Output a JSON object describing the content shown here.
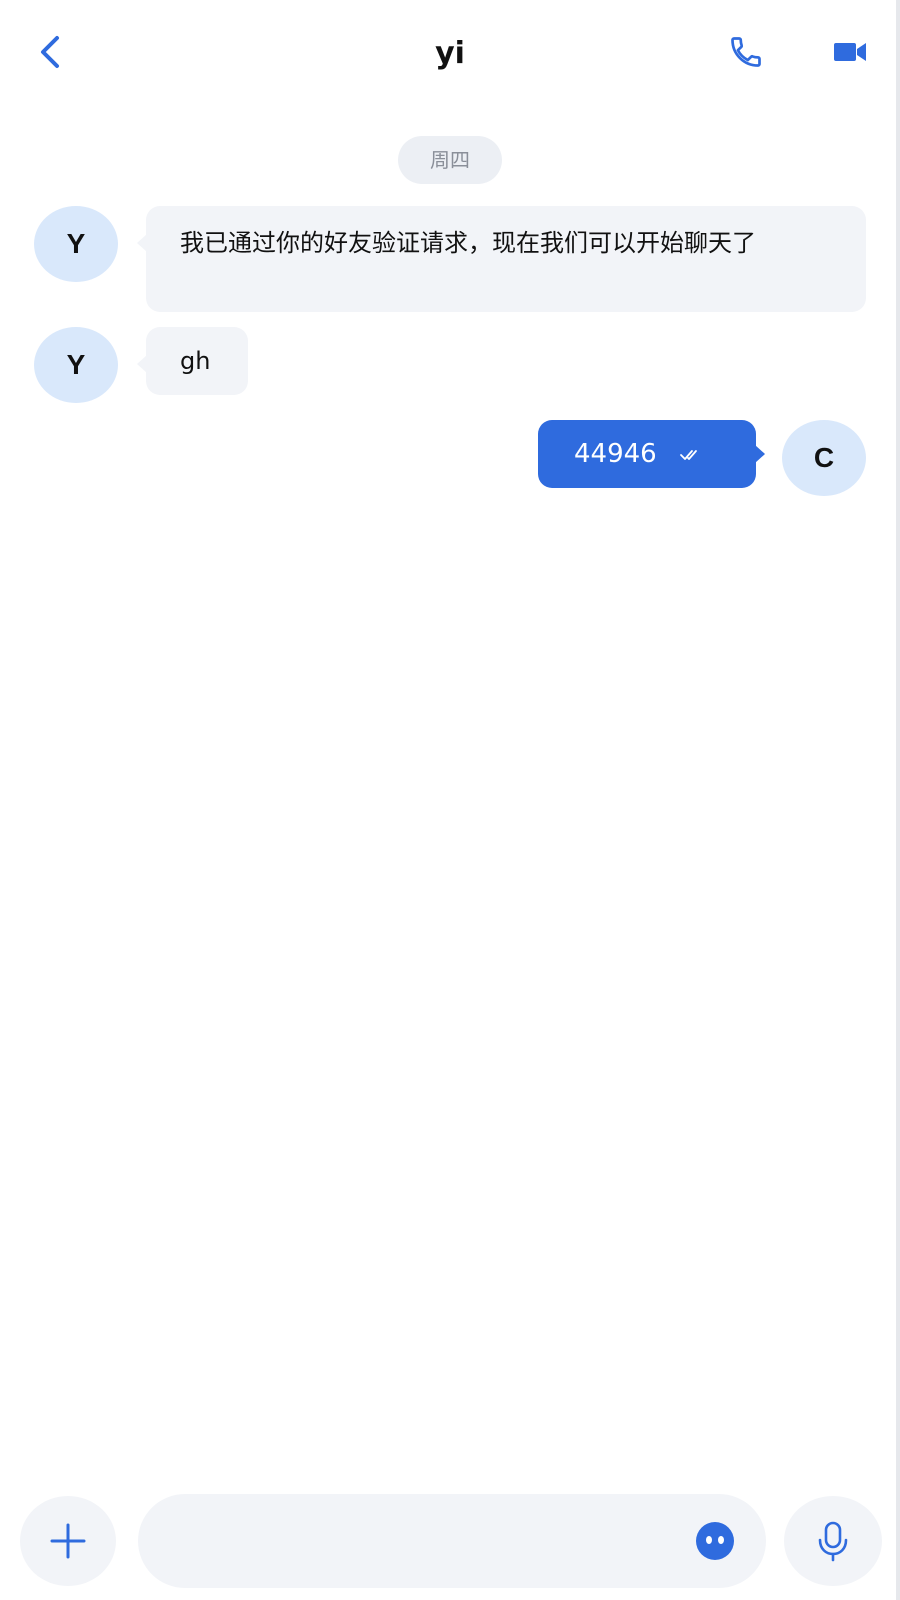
{
  "header": {
    "title": "yi",
    "back_icon": "chevron-left-icon",
    "call_icon": "phone-icon",
    "video_icon": "video-camera-icon"
  },
  "date_separator": "周四",
  "messages": [
    {
      "sender": "Y",
      "direction": "incoming",
      "text": "我已通过你的好友验证请求，现在我们可以开始聊天了"
    },
    {
      "sender": "Y",
      "direction": "incoming",
      "text": "gh"
    },
    {
      "sender": "C",
      "direction": "outgoing",
      "text": "44946",
      "status_icon": "double-check-icon"
    }
  ],
  "composer": {
    "plus_icon": "plus-icon",
    "input_value": "",
    "emoji_icon": "emoji-icon",
    "mic_icon": "microphone-icon"
  },
  "colors": {
    "accent": "#2f6bde",
    "avatar_bg": "#d9e8fb",
    "bubble_bg": "#f2f4f8",
    "date_pill_bg": "#eceff4"
  }
}
